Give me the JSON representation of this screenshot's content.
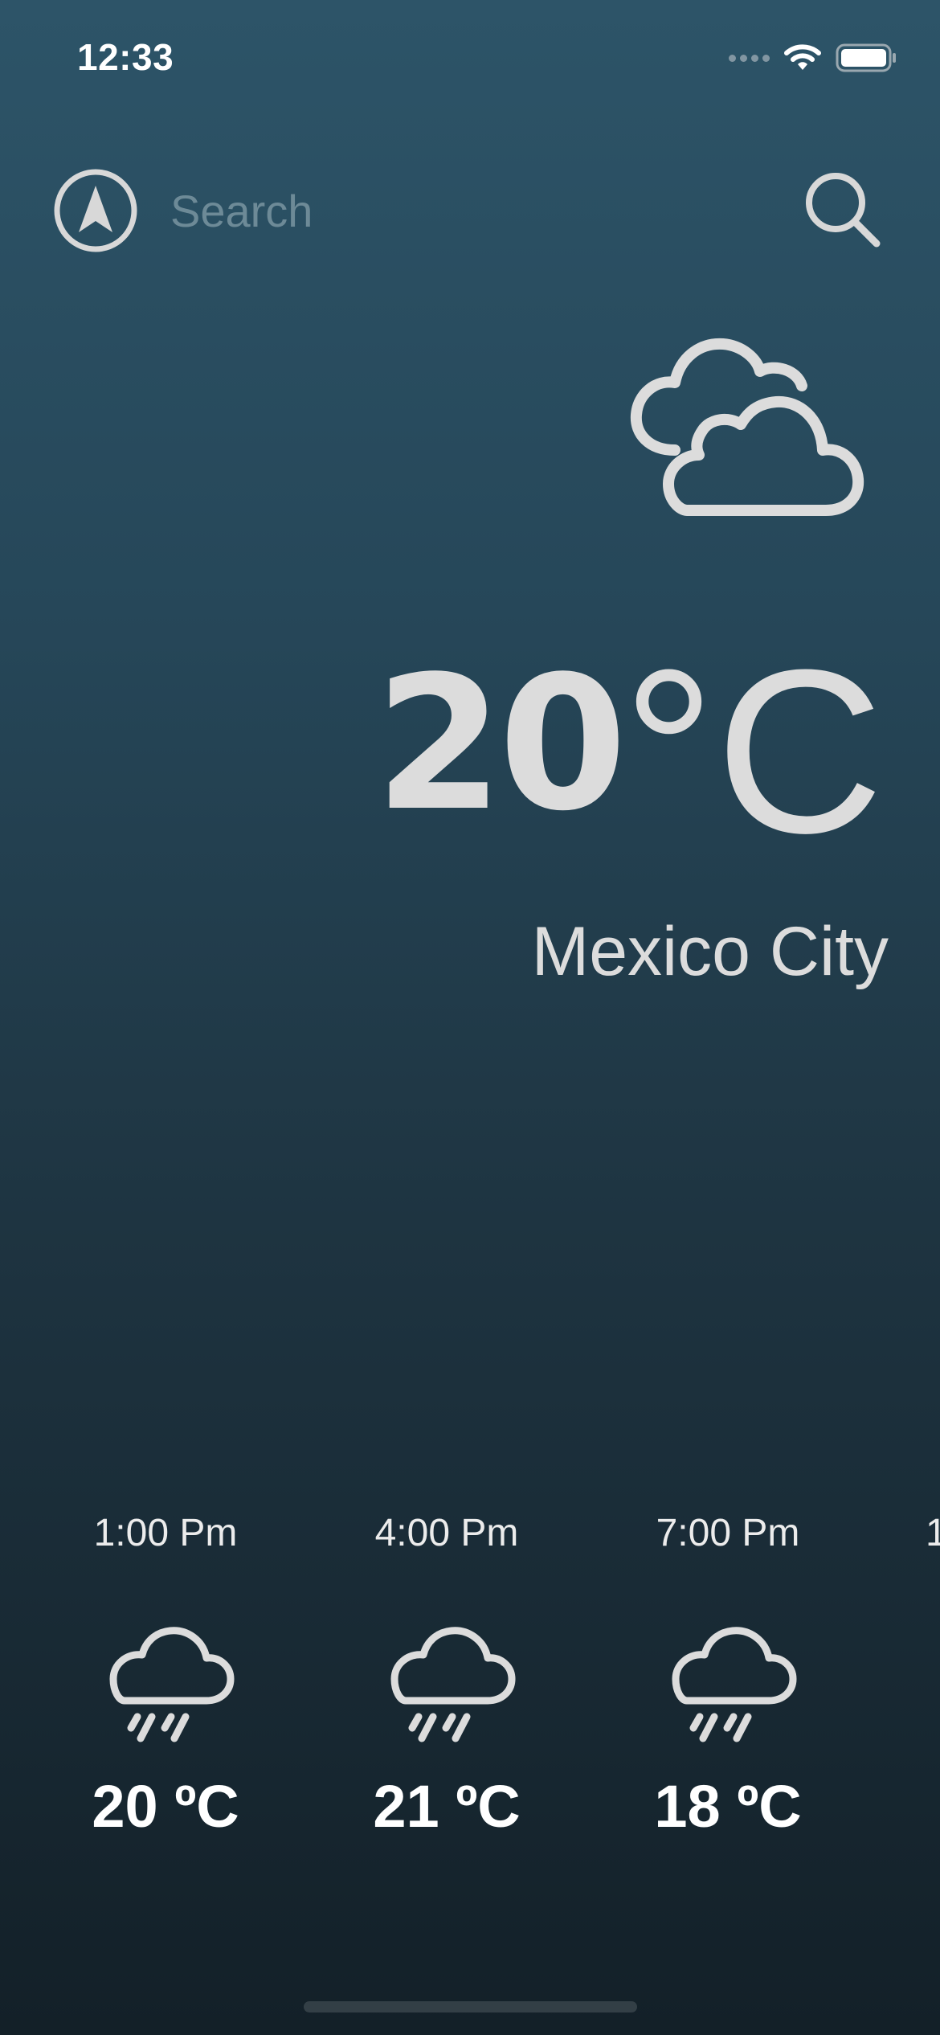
{
  "status_bar": {
    "time": "12:33"
  },
  "search": {
    "placeholder": "Search",
    "value": ""
  },
  "current": {
    "temperature": "20",
    "unit": "°C",
    "city": "Mexico City",
    "icon": "cloud-icon"
  },
  "forecast": [
    {
      "time": "1:00 Pm",
      "temp": "20 ºC",
      "icon": "rain-cloud-icon"
    },
    {
      "time": "4:00 Pm",
      "temp": "21 ºC",
      "icon": "rain-cloud-icon"
    },
    {
      "time": "7:00 Pm",
      "temp": "18 ºC",
      "icon": "rain-cloud-icon"
    },
    {
      "time": "1",
      "temp": "",
      "icon": "rain-cloud-icon"
    }
  ],
  "colors": {
    "background_top": "#2d5468",
    "background_bottom": "#132028",
    "foreground": "#dedede",
    "placeholder": "#6d8a97"
  }
}
